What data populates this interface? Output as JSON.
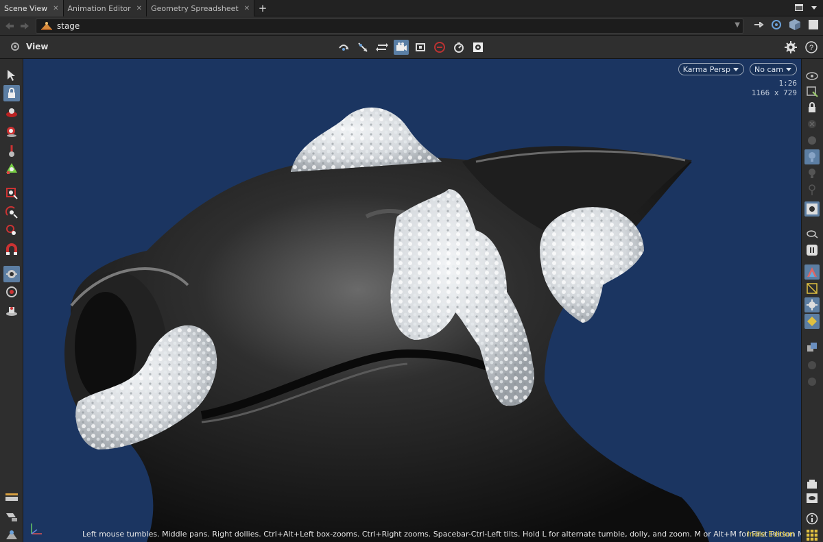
{
  "tabs": [
    {
      "label": "Scene View",
      "active": true
    },
    {
      "label": "Animation Editor",
      "active": false
    },
    {
      "label": "Geometry Spreadsheet",
      "active": false
    }
  ],
  "path": {
    "value": "stage"
  },
  "view": {
    "label": "View"
  },
  "viewport": {
    "renderer": "Karma  Persp",
    "camera": "No cam",
    "aspect": "1:26",
    "resolution": "1166 x 729",
    "status_text": "Left mouse tumbles. Middle pans. Right dollies. Ctrl+Alt+Left box-zooms. Ctrl+Right zooms. Spacebar-Ctrl-Left tilts. Hold L for alternate tumble, dolly, and zoom.     M or Alt+M for First Person Navigation.",
    "edition": "Indie Edition"
  },
  "colors": {
    "viewport_bg": "#1b3561",
    "tool_active": "#5c7ea3",
    "edition": "#e0c63c"
  },
  "icons": {
    "left_tools": [
      "select-icon",
      "view-lock-icon",
      "handle-icon",
      "pose-icon",
      "paint-icon",
      "transform-icon",
      "scale-icon",
      "rotate-icon",
      "snap-icon",
      "magnet-icon",
      "light-icon",
      "camera-icon",
      "render-region-icon",
      "light-bulb-icon",
      "visibility-icon"
    ],
    "right_tools": [
      "display-options-icon",
      "shading-icon",
      "lock-icon",
      "ghost-icon",
      "sphere-icon",
      "bulb-icon",
      "bulb2-icon",
      "pin-icon",
      "snapshot-icon",
      "eye-link-icon",
      "pause-icon",
      "color-icon",
      "wire-icon",
      "geo-icon",
      "selection-icon",
      "group-icon",
      "circle-icon",
      "circle2-icon",
      "render-icon",
      "view-icon",
      "info-icon",
      "grid-icon"
    ]
  }
}
